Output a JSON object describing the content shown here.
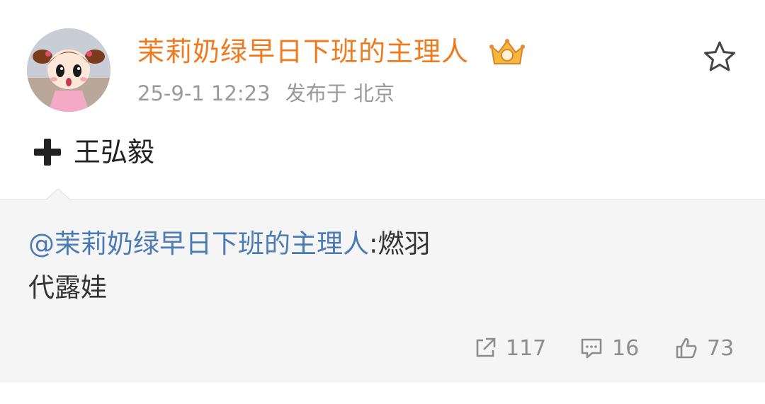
{
  "post": {
    "username": "茉莉奶绿早日下班的主理人",
    "timestamp": "25-9-1 12:23",
    "location": "发布于 北京",
    "content": "王弘毅",
    "icons": {
      "avatar": "cartoon-girl-avatar",
      "badge": "vip-crown-badge-icon",
      "favorite": "star-outline-icon",
      "prefix": "plus-icon"
    }
  },
  "repost": {
    "mention": "@茉莉奶绿早日下班的主理人",
    "text_after_mention": ":燃羽",
    "line2": "代露娃"
  },
  "actions": {
    "repost_count": "117",
    "comment_count": "16",
    "like_count": "73",
    "icons": [
      "share-icon",
      "comment-icon",
      "thumbs-up-icon"
    ]
  },
  "colors": {
    "username": "#f07b1f",
    "mention": "#4a7bb5",
    "meta": "#9a9a9a",
    "repost_bg": "#f5f5f5"
  }
}
